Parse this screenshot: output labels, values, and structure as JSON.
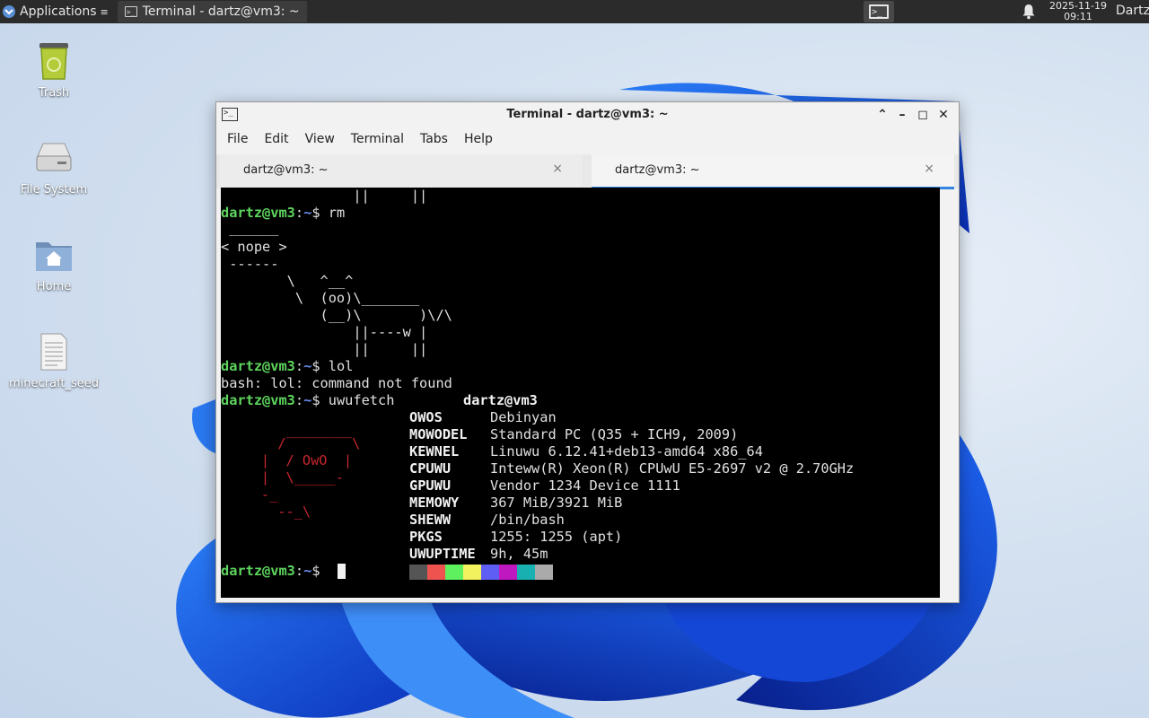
{
  "panel": {
    "applications_label": "Applications",
    "task_label": "Terminal - dartz@vm3: ~",
    "date": "2025-11-19",
    "time": "09:11",
    "user": "Dartz"
  },
  "desktop": {
    "icons": [
      {
        "label": "Trash"
      },
      {
        "label": "File System"
      },
      {
        "label": "Home"
      },
      {
        "label": "minecraft_seed"
      }
    ]
  },
  "window": {
    "title": "Terminal - dartz@vm3: ~",
    "menu": [
      "File",
      "Edit",
      "View",
      "Terminal",
      "Tabs",
      "Help"
    ],
    "tabs": [
      {
        "label": "dartz@vm3: ~",
        "close": "×"
      },
      {
        "label": "dartz@vm3: ~",
        "close": "×"
      }
    ]
  },
  "terminal": {
    "prompt_user": "dartz@vm3",
    "prompt_sep": ":",
    "prompt_path": "~",
    "prompt_dollar": "$ ",
    "cow_top": "                ||     ||",
    "cmd1": "rm",
    "bubble_top": " ______",
    "bubble_text": "< nope >",
    "bubble_bottom": " ------",
    "cow1": "        \\   ^__^",
    "cow2": "         \\  (oo)\\_______",
    "cow3": "            (__)\\       )\\/\\",
    "cow4": "                ||----w |",
    "cow5": "                ||     ||",
    "cmd2": "lol",
    "err": "bash: lol: command not found",
    "cmd3": "uwufetch",
    "host": "dartz@vm3",
    "logo": [
      "      /‾‾‾‾‾‾‾‾\\",
      "    |  / OwO  |",
      "    |  \\_____-",
      "    -_",
      "      --_\\"
    ],
    "info": [
      {
        "key": "OWOS",
        "val": "Debinyan"
      },
      {
        "key": "MOWODEL",
        "val": "Standard PC (Q35 + ICH9, 2009)"
      },
      {
        "key": "KEWNEL",
        "val": "Linuwu 6.12.41+deb13-amd64 x86_64"
      },
      {
        "key": "CPUWU",
        "val": "Inteww(R) Xeon(R) CPUwU E5-2697 v2 @ 2.70GHz"
      },
      {
        "key": "GPUWU",
        "val": "Vendor 1234 Device 1111"
      },
      {
        "key": "MEMOWY",
        "val": "367 MiB/3921 MiB"
      },
      {
        "key": "SHEWW",
        "val": "/bin/bash"
      },
      {
        "key": "PKGS",
        "val": "1255: 1255 (apt)"
      },
      {
        "key": "UWUPTIME",
        "val": "9h, 45m"
      }
    ],
    "palette": [
      "#555555",
      "#ef5350",
      "#5ef05e",
      "#f2f25e",
      "#5e5ef5",
      "#c018c0",
      "#18b0b0",
      "#aaaaaa"
    ]
  }
}
